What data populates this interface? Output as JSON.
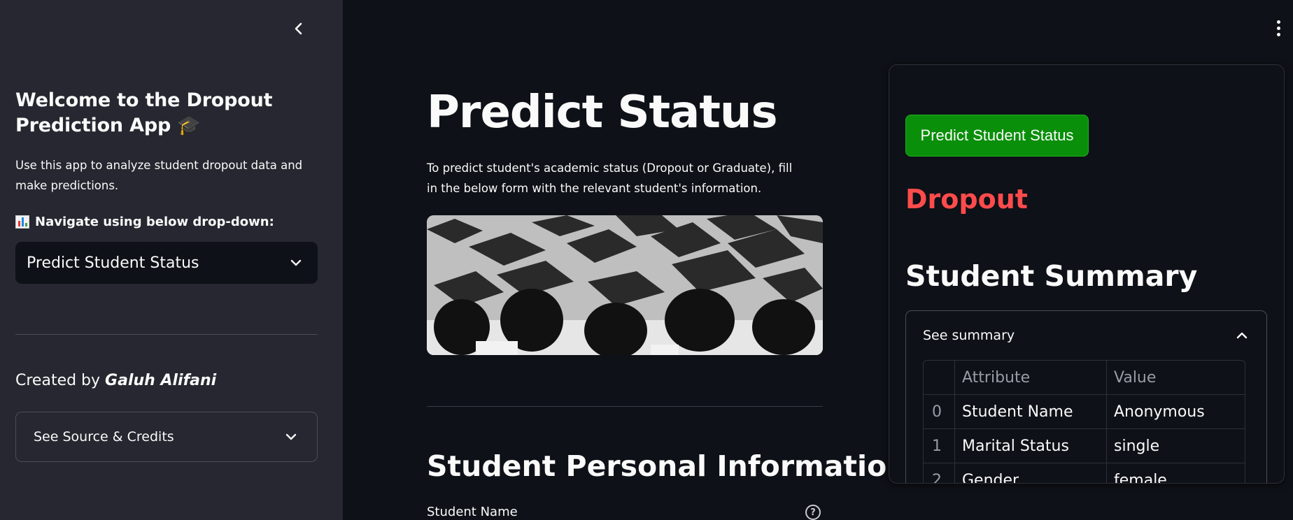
{
  "sidebar": {
    "title": "Welcome to the Dropout Prediction App",
    "title_emoji": "🎓",
    "description": "Use this app to analyze student dropout data and make predictions.",
    "nav_label": "Navigate using below drop-down:",
    "nav_select_value": "Predict Student Status",
    "created_by_prefix": "Created by ",
    "created_by_name": "Galuh Alifani",
    "credits_expander": "See Source & Credits"
  },
  "main": {
    "title": "Predict Status",
    "description": "To predict student's academic status (Dropout or Graduate), fill in the below form with the relevant student's information.",
    "section_title": "Student Personal Information",
    "field_label": "Student Name",
    "help_icon_glyph": "?"
  },
  "panel": {
    "predict_button": "Predict Student Status",
    "result": "Dropout",
    "result_color": "#ff4b4b",
    "summary_title": "Student Summary",
    "expander_label": "See summary",
    "table": {
      "headers": [
        "",
        "Attribute",
        "Value"
      ],
      "rows": [
        [
          "0",
          "Student Name",
          "Anonymous"
        ],
        [
          "1",
          "Marital Status",
          "single"
        ],
        [
          "2",
          "Gender",
          "female"
        ]
      ]
    }
  },
  "icons": {
    "collapse": "chevron-left-icon",
    "menu": "kebab-menu-icon",
    "select": "chevron-down-icon",
    "expander_open": "chevron-up-icon"
  },
  "colors": {
    "sidebar_bg": "#262730",
    "app_bg": "#0e1117",
    "button_green": "#0a8f0a"
  }
}
